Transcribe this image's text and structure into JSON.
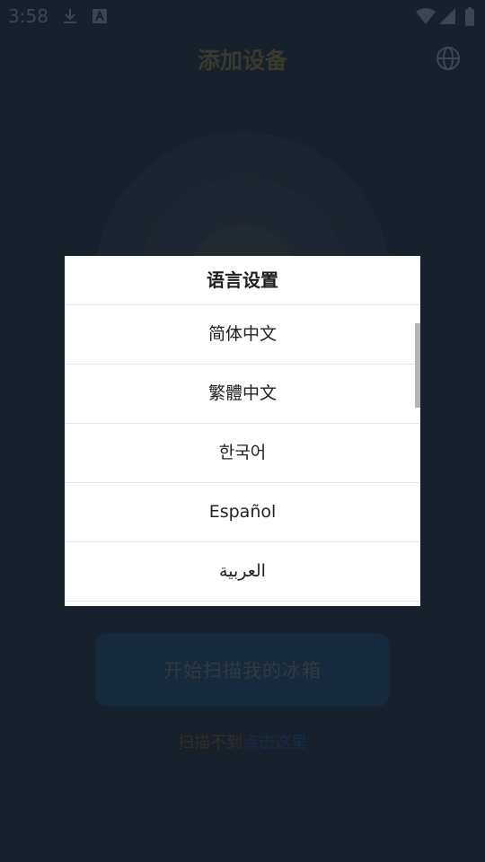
{
  "status_bar": {
    "time": "3:58",
    "icons": [
      "download-icon",
      "font-icon",
      "wifi-icon",
      "signal-icon",
      "battery-icon"
    ]
  },
  "header": {
    "title": "添加设备",
    "globe_icon": "globe-icon"
  },
  "main": {
    "scan_button_label": "开始扫描我的冰箱",
    "help_text": "扫描不到",
    "help_link": "点击这里"
  },
  "dialog": {
    "title": "语言设置",
    "options": [
      "简体中文",
      "繁體中文",
      "한국어",
      "Español",
      "العربية"
    ]
  },
  "colors": {
    "background": "#16212c",
    "dialog_bg": "#ffffff",
    "divider": "#e6e6e6",
    "link": "#152e46"
  }
}
